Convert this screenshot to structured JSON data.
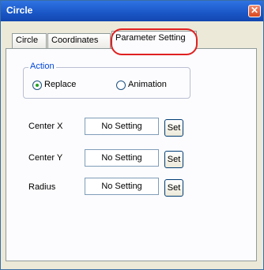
{
  "window": {
    "title": "Circle",
    "close_icon": "close-icon"
  },
  "tabs": [
    {
      "label": "Circle"
    },
    {
      "label": "Coordinates"
    },
    {
      "label": "Parameter Setting",
      "active": true
    }
  ],
  "action": {
    "label": "Action",
    "options": [
      {
        "label": "Replace",
        "selected": true
      },
      {
        "label": "Animation",
        "selected": false
      }
    ]
  },
  "parameters": [
    {
      "label": "Center X",
      "value": "No Setting",
      "button": "Set"
    },
    {
      "label": "Center Y",
      "value": "No Setting",
      "button": "Set"
    },
    {
      "label": "Radius",
      "value": "No Setting",
      "button": "Set"
    }
  ],
  "colors": {
    "annotation": "#e02020",
    "titlebar": "#1a56c6"
  }
}
